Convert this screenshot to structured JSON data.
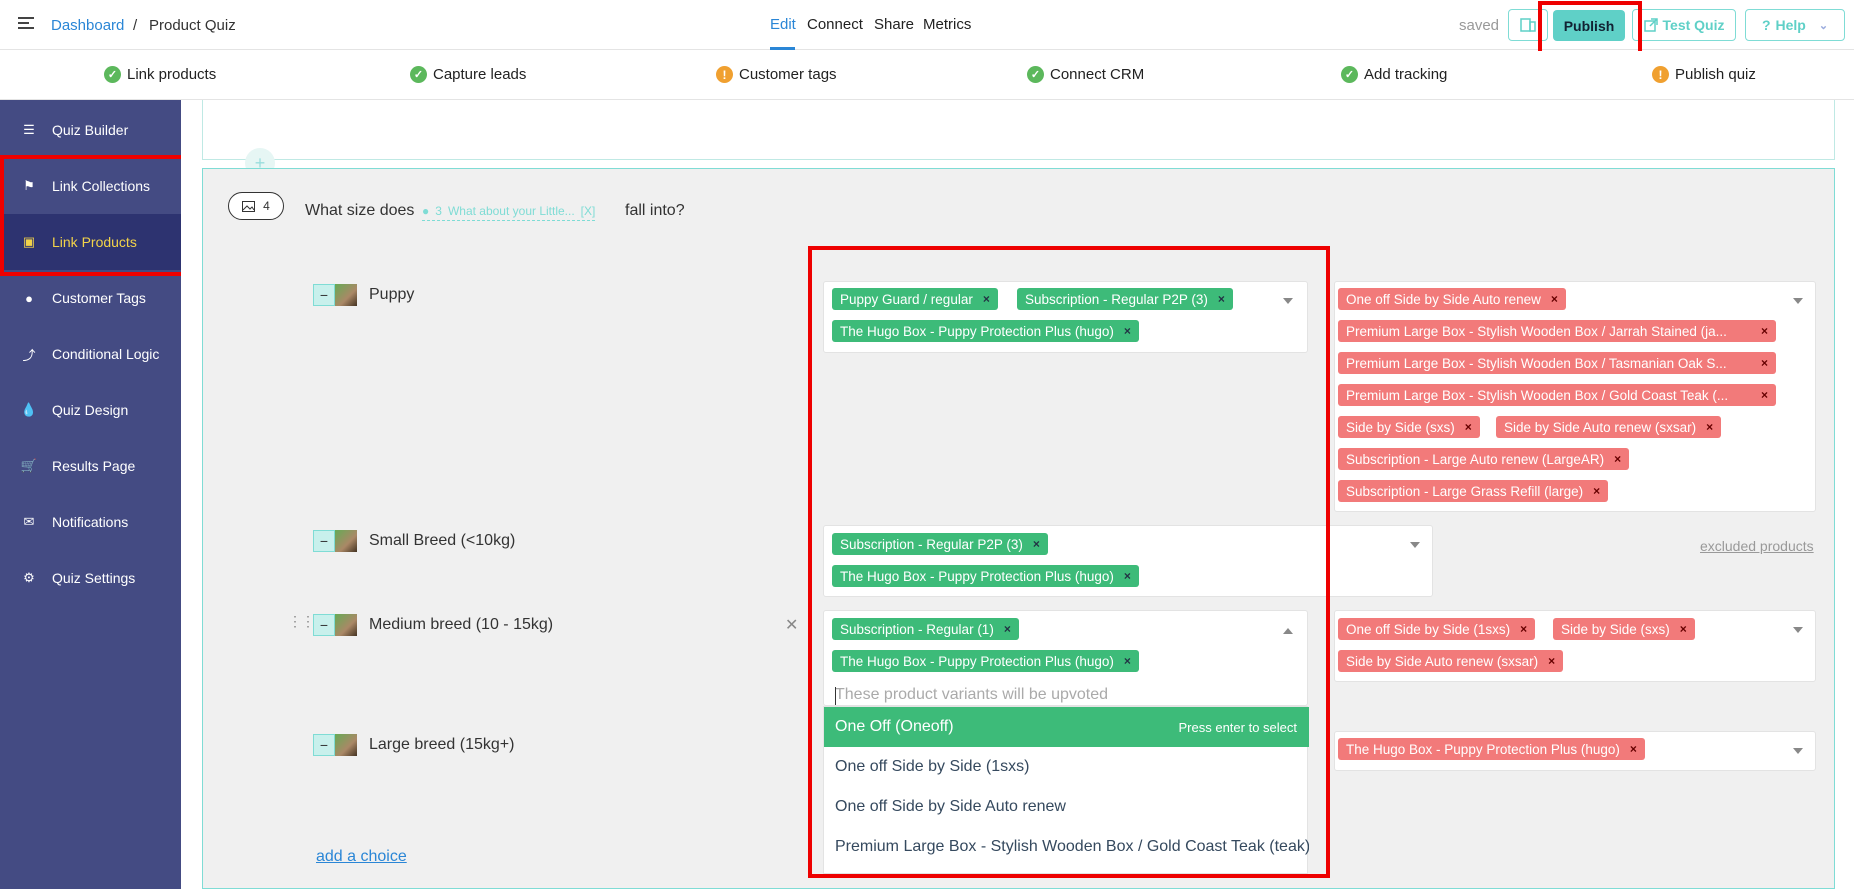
{
  "breadcrumb": {
    "root": "Dashboard",
    "sep": "/",
    "current": "Product Quiz"
  },
  "tabs": [
    "Edit",
    "Connect",
    "Share",
    "Metrics"
  ],
  "header": {
    "saved": "saved",
    "publish": "Publish",
    "test_quiz": "Test Quiz",
    "help": "Help"
  },
  "steps": [
    {
      "label": "Link products",
      "status": "done"
    },
    {
      "label": "Capture leads",
      "status": "done"
    },
    {
      "label": "Customer tags",
      "status": "warning"
    },
    {
      "label": "Connect CRM",
      "status": "done"
    },
    {
      "label": "Add tracking",
      "status": "done"
    },
    {
      "label": "Publish quiz",
      "status": "warning"
    }
  ],
  "sidebar": [
    {
      "label": "Quiz Builder",
      "icon": "list-icon"
    },
    {
      "label": "Link Collections",
      "icon": "tag-icon"
    },
    {
      "label": "Link Products",
      "icon": "box-icon",
      "active": true
    },
    {
      "label": "Customer Tags",
      "icon": "user-icon"
    },
    {
      "label": "Conditional Logic",
      "icon": "branch-icon"
    },
    {
      "label": "Quiz Design",
      "icon": "droplet-icon"
    },
    {
      "label": "Results Page",
      "icon": "cart-icon"
    },
    {
      "label": "Notifications",
      "icon": "envelope-icon"
    },
    {
      "label": "Quiz Settings",
      "icon": "gear-icon"
    }
  ],
  "question": {
    "image_count": "4",
    "text_before": "What size does",
    "ref_num": "3",
    "ref_text": "What about your Little...",
    "ref_close": "[X]",
    "text_after": "fall into?"
  },
  "choices": [
    {
      "label": "Puppy",
      "upvote": [
        "Puppy Guard / regular",
        "Subscription - Regular P2P (3)",
        "The Hugo Box - Puppy Protection Plus (hugo)"
      ],
      "exclude": [
        "One off Side by Side Auto renew",
        "Premium Large Box - Stylish Wooden Box / Jarrah Stained (ja...",
        "Premium Large Box - Stylish Wooden Box / Tasmanian Oak S...",
        "Premium Large Box - Stylish Wooden Box / Gold Coast Teak (...",
        "Side by Side (sxs)",
        "Side by Side Auto renew (sxsar)",
        "Subscription - Large Auto renew (LargeAR)",
        "Subscription - Large Grass Refill (large)"
      ]
    },
    {
      "label": "Small Breed (<10kg)",
      "upvote": [
        "Subscription - Regular P2P (3)",
        "The Hugo Box - Puppy Protection Plus (hugo)"
      ],
      "exclude": []
    },
    {
      "label": "Medium breed (10 - 15kg)",
      "upvote": [
        "Subscription - Regular (1)",
        "The Hugo Box - Puppy Protection Plus (hugo)"
      ],
      "exclude": [
        "One off Side by Side (1sxs)",
        "Side by Side (sxs)",
        "Side by Side Auto renew (sxsar)"
      ]
    },
    {
      "label": "Large breed (15kg+)",
      "upvote": [],
      "exclude": [
        "The Hugo Box - Puppy Protection Plus (hugo)"
      ]
    }
  ],
  "excluded_link": "excluded products",
  "dropdown": {
    "placeholder": "These product variants will be upvoted",
    "hint": "Press enter to select",
    "options": [
      "One Off (Oneoff)",
      "One off Side by Side (1sxs)",
      "One off Side by Side Auto renew",
      "Premium Large Box - Stylish Wooden Box / Gold Coast Teak (teak)"
    ]
  },
  "add_choice": "add a choice",
  "colors": {
    "accent": "#5fd0c7",
    "sidebar": "#444b83",
    "sidebar_active": "#2d3370",
    "upvote_tag": "#3dbb79",
    "exclude_tag": "#f27a7a",
    "highlight": "#e00000"
  }
}
